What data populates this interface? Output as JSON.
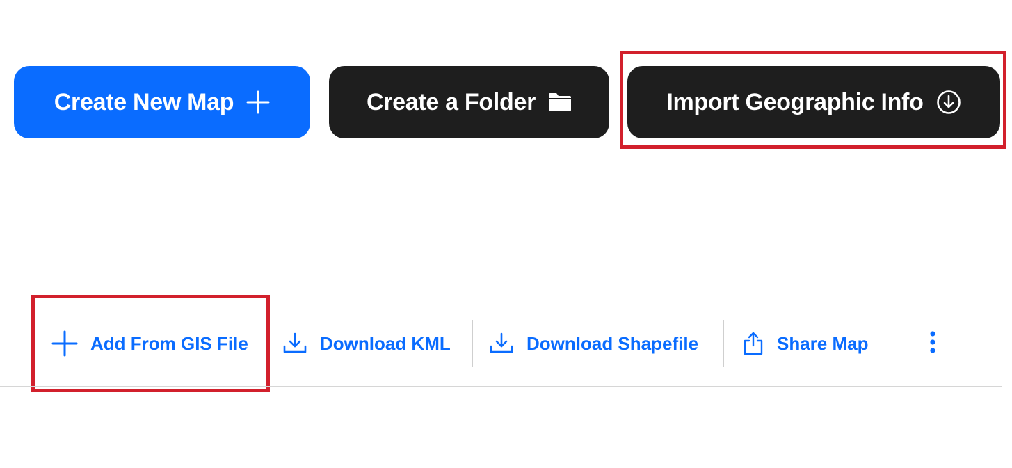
{
  "colors": {
    "accent": "#0a6cff",
    "dark": "#1e1e1e",
    "highlight": "#d2202c"
  },
  "top_actions": {
    "create_map": {
      "label": "Create New Map",
      "icon": "plus-icon"
    },
    "create_folder": {
      "label": "Create a Folder",
      "icon": "folder-icon"
    },
    "import_geo": {
      "label": "Import Geographic Info",
      "icon": "circle-download-icon"
    }
  },
  "toolbar": {
    "add_gis": {
      "label": "Add From GIS File",
      "icon": "plus-icon"
    },
    "download_kml": {
      "label": "Download KML",
      "icon": "download-icon"
    },
    "download_shapefile": {
      "label": "Download Shapefile",
      "icon": "download-icon"
    },
    "share_map": {
      "label": "Share Map",
      "icon": "share-icon"
    },
    "more": {
      "icon": "more-vertical-icon"
    }
  }
}
